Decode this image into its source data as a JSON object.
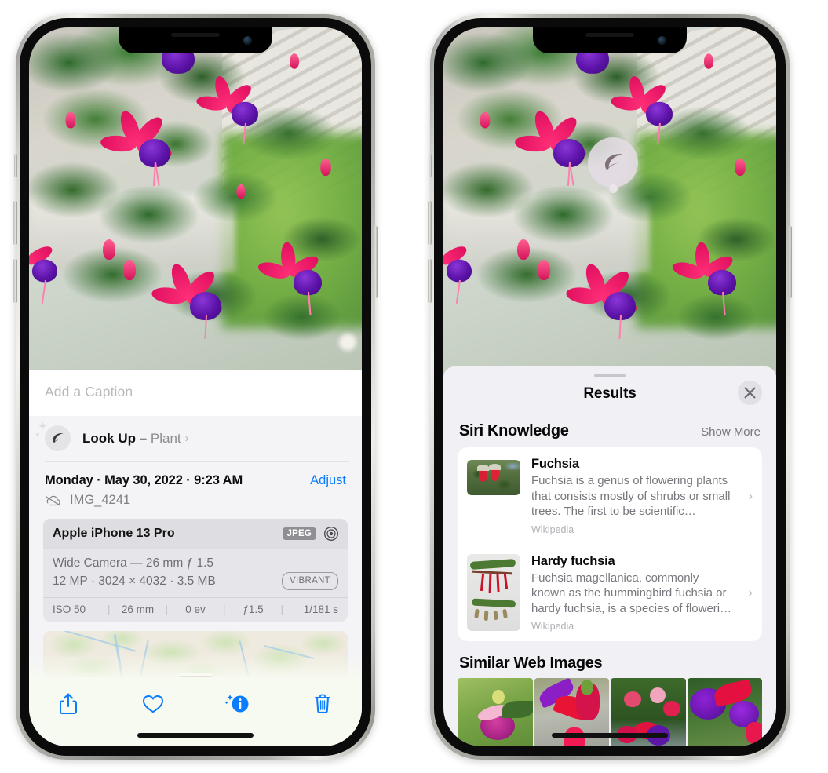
{
  "left_phone": {
    "name": "iphone-photos-info",
    "caption": {
      "placeholder": "Add a Caption"
    },
    "lookup": {
      "icon": "leaf-icon",
      "label": "Look Up",
      "dash": " – ",
      "kind": "Plant",
      "chevron": "›"
    },
    "meta": {
      "date": "Monday · May 30, 2022 · 9:23 AM",
      "adjust": "Adjust",
      "cloud_icon": "icloud-slash-icon",
      "filename": "IMG_4241"
    },
    "camera": {
      "device": "Apple iPhone 13 Pro",
      "format_badge": "JPEG",
      "aperture_icon": "aperture-icon",
      "lens_line": "Wide Camera — 26 mm ƒ 1.5",
      "specs_line": "12 MP · 3024 × 4032 · 3.5 MB",
      "style_badge": "VIBRANT",
      "exif": [
        {
          "label": "ISO 50"
        },
        {
          "label": "26 mm"
        },
        {
          "label": "0 ev"
        },
        {
          "label": "ƒ1.5"
        },
        {
          "label": "1/181 s"
        }
      ]
    },
    "map": {
      "name": "photo-location-map"
    },
    "toolbar": [
      {
        "name": "share-button",
        "icon": "share-icon"
      },
      {
        "name": "favorite-button",
        "icon": "heart-icon"
      },
      {
        "name": "info-button",
        "icon": "info-sparkle-icon"
      },
      {
        "name": "delete-button",
        "icon": "trash-icon"
      }
    ]
  },
  "right_phone": {
    "name": "iphone-visual-lookup-results",
    "photo_badge": {
      "icon": "leaf-icon"
    },
    "sheet": {
      "title": "Results",
      "close_label": "×"
    },
    "siri_knowledge": {
      "title": "Siri Knowledge",
      "action": "Show More",
      "items": [
        {
          "title": "Fuchsia",
          "description": "Fuchsia is a genus of flowering plants that consists mostly of shrubs or small trees. The first to be scientific…",
          "source": "Wikipedia",
          "chevron": "›"
        },
        {
          "title": "Hardy fuchsia",
          "description": "Fuchsia magellanica, commonly known as the hummingbird fuchsia or hardy fuchsia, is a species of floweri…",
          "source": "Wikipedia",
          "chevron": "›"
        }
      ]
    },
    "similar_web_images": {
      "title": "Similar Web Images",
      "count": 4
    }
  },
  "colors": {
    "accent_blue": "#0a7cff",
    "sheet_bg": "#f0f0f5",
    "card_bg": "#ffffff",
    "secondary_text": "#77777d",
    "toolbar_bg": "#f7faf0"
  }
}
